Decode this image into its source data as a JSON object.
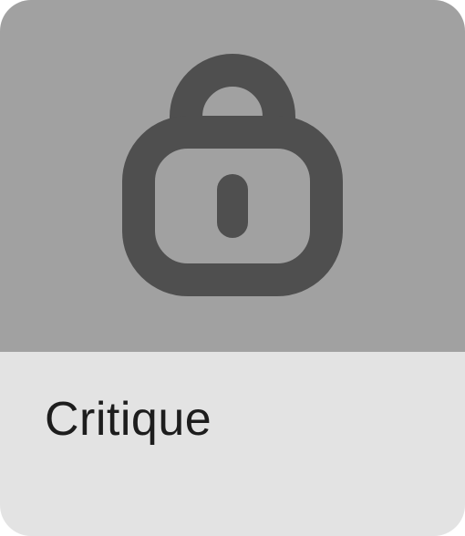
{
  "tile": {
    "label": "Critique",
    "icon": "lock-icon"
  },
  "colors": {
    "icon_area": "#a1a1a1",
    "label_area": "#e3e3e3",
    "icon": "#4f4f4f",
    "text": "#1d1d1d"
  }
}
